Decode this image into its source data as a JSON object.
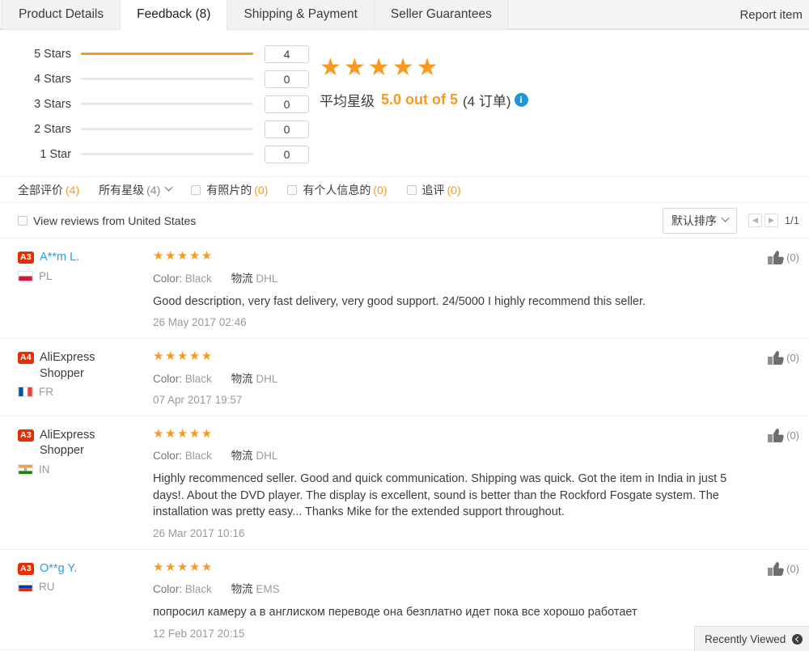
{
  "tabs": [
    {
      "label": "Product Details",
      "active": false
    },
    {
      "label": "Feedback (8)",
      "active": true
    },
    {
      "label": "Shipping & Payment",
      "active": false
    },
    {
      "label": "Seller Guarantees",
      "active": false
    }
  ],
  "report_item_label": "Report item",
  "rating_breakdown": {
    "rows": [
      {
        "label": "5 Stars",
        "count": "4",
        "percent": 100
      },
      {
        "label": "4 Stars",
        "count": "0",
        "percent": 0
      },
      {
        "label": "3 Stars",
        "count": "0",
        "percent": 0
      },
      {
        "label": "2 Stars",
        "count": "0",
        "percent": 0
      },
      {
        "label": "1 Star",
        "count": "0",
        "percent": 0
      }
    ]
  },
  "average": {
    "stars_glyph": "★★★★★",
    "prefix_label": "平均星级",
    "score_text": "5.0 out of 5",
    "orders_text": "(4 订单)",
    "info_glyph": "i",
    "bar_color": "#f79a1f",
    "info_color": "#2196d6"
  },
  "filters": {
    "all_reviews": {
      "label": "全部评价",
      "count": "(4)"
    },
    "all_stars": {
      "label": "所有星级",
      "count": "(4)"
    },
    "with_photos": {
      "label": "有照片的",
      "count": "(0)"
    },
    "with_personal_info": {
      "label": "有个人信息的",
      "count": "(0)"
    },
    "additional": {
      "label": "追评",
      "count": "(0)"
    }
  },
  "sort_row": {
    "view_from_label": "View reviews from United States",
    "sort_label": "默认排序",
    "prev_glyph": "◀",
    "next_glyph": "▶",
    "page_indicator": "1/1"
  },
  "reviews": [
    {
      "badge": "A3",
      "username": "A**m L.",
      "username_is_link": true,
      "country_code": "PL",
      "flag": "pl",
      "stars": "★★★★★",
      "color_key": "Color:",
      "color_value": "Black",
      "logistics_key": "物流",
      "logistics_value": "DHL",
      "text": "Good description, very fast delivery, very good support. 24/5000 I highly recommend this seller.",
      "date": "26 May 2017 02:46",
      "like_count": "(0)"
    },
    {
      "badge": "A4",
      "username": "AliExpress Shopper",
      "username_is_link": false,
      "country_code": "FR",
      "flag": "fr",
      "stars": "★★★★★",
      "color_key": "Color:",
      "color_value": "Black",
      "logistics_key": "物流",
      "logistics_value": "DHL",
      "text": "",
      "date": "07 Apr 2017 19:57",
      "like_count": "(0)"
    },
    {
      "badge": "A3",
      "username": "AliExpress Shopper",
      "username_is_link": false,
      "country_code": "IN",
      "flag": "in",
      "stars": "★★★★★",
      "color_key": "Color:",
      "color_value": "Black",
      "logistics_key": "物流",
      "logistics_value": "DHL",
      "text": "Highly recommenced seller. Good and quick communication. Shipping was quick. Got the item in India in just 5 days!. About the DVD player. The display is excellent, sound is better than the Rockford Fosgate system. The installation was pretty easy... Thanks Mike for the extended support throughout.",
      "date": "26 Mar 2017 10:16",
      "like_count": "(0)"
    },
    {
      "badge": "A3",
      "username": "O**g Y.",
      "username_is_link": true,
      "country_code": "RU",
      "flag": "ru",
      "stars": "★★★★★",
      "color_key": "Color:",
      "color_value": "Black",
      "logistics_key": "物流",
      "logistics_value": "EMS",
      "text": "попросил камеру а в англиском переводе она безплатно идет пока все хорошо работает",
      "date": "12 Feb 2017 20:15",
      "like_count": "(0)"
    }
  ],
  "recently_viewed": {
    "label": "Recently Viewed"
  }
}
